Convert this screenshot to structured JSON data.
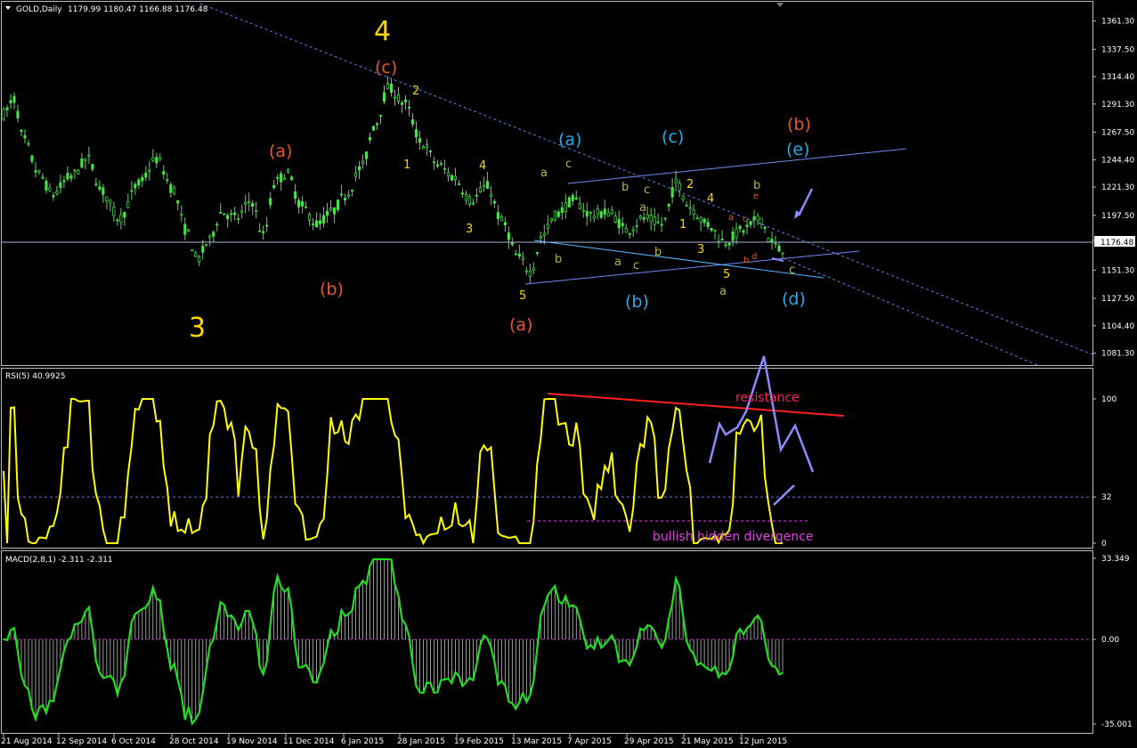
{
  "main": {
    "symbol": "GOLD,Daily",
    "ohlc": "1179.99 1180.47 1166.88 1176.48",
    "current_price": "1176.48",
    "price_axis": [
      "1361.30",
      "1337.50",
      "1314.40",
      "1291.30",
      "1267.50",
      "1244.40",
      "1221.30",
      "1197.50",
      "1176.48",
      "1151.30",
      "1127.50",
      "1104.40",
      "1081.30"
    ],
    "wave_labels": [
      {
        "text": "4",
        "color": "#ffd700",
        "size": "big"
      },
      {
        "text": "3",
        "color": "#ffd700",
        "size": "big"
      },
      {
        "text": "(c)",
        "color": "#e8572a",
        "size": "mid"
      },
      {
        "text": "(a)",
        "color": "#e8572a",
        "size": "mid"
      },
      {
        "text": "(b)",
        "color": "#e8572a",
        "size": "mid"
      },
      {
        "text": "(a)",
        "color": "#e8572a",
        "size": "mid"
      },
      {
        "text": "(b)",
        "color": "#e8572a",
        "size": "mid"
      },
      {
        "text": "(a)",
        "color": "#29a9e8",
        "size": "mid"
      },
      {
        "text": "(c)",
        "color": "#29a9e8",
        "size": "mid"
      },
      {
        "text": "(e)",
        "color": "#29a9e8",
        "size": "mid"
      },
      {
        "text": "(b)",
        "color": "#29a9e8",
        "size": "mid"
      },
      {
        "text": "(d)",
        "color": "#29a9e8",
        "size": "mid"
      },
      {
        "text": "2",
        "color": "#ffd700",
        "size": "small"
      },
      {
        "text": "1",
        "color": "#ffd700",
        "size": "small"
      },
      {
        "text": "4",
        "color": "#ffd700",
        "size": "small"
      },
      {
        "text": "3",
        "color": "#ffd700",
        "size": "small"
      },
      {
        "text": "5",
        "color": "#ffd700",
        "size": "small"
      },
      {
        "text": "2",
        "color": "#ffd700",
        "size": "small"
      },
      {
        "text": "1",
        "color": "#ffd700",
        "size": "small"
      },
      {
        "text": "4",
        "color": "#ffd700",
        "size": "small"
      },
      {
        "text": "3",
        "color": "#ffd700",
        "size": "small"
      },
      {
        "text": "5",
        "color": "#ffd700",
        "size": "small"
      },
      {
        "text": "a",
        "color": "#b5b542",
        "size": "small"
      },
      {
        "text": "c",
        "color": "#b5b542",
        "size": "small"
      },
      {
        "text": "b",
        "color": "#b5b542",
        "size": "small"
      },
      {
        "text": "a",
        "color": "#b5b542",
        "size": "small"
      },
      {
        "text": "c",
        "color": "#b5b542",
        "size": "small"
      },
      {
        "text": "b",
        "color": "#b5b542",
        "size": "small"
      },
      {
        "text": "b",
        "color": "#b5b542",
        "size": "small"
      },
      {
        "text": "c",
        "color": "#b5b542",
        "size": "small"
      },
      {
        "text": "a",
        "color": "#b5b542",
        "size": "small"
      },
      {
        "text": "b",
        "color": "#b5b542",
        "size": "small"
      },
      {
        "text": "a",
        "color": "#b5b542",
        "size": "small"
      },
      {
        "text": "c",
        "color": "#b5b542",
        "size": "small"
      },
      {
        "text": "a",
        "color": "#e8572a",
        "size": "tiny"
      },
      {
        "text": "c",
        "color": "#e8572a",
        "size": "tiny"
      },
      {
        "text": "e",
        "color": "#e8572a",
        "size": "tiny"
      },
      {
        "text": "b",
        "color": "#e8572a",
        "size": "tiny"
      },
      {
        "text": "d",
        "color": "#e8572a",
        "size": "tiny"
      }
    ]
  },
  "rsi": {
    "label": "RSI(5) 40.9925",
    "axis": [
      "100",
      "32",
      "0"
    ],
    "annotations": {
      "resistance": "resistance",
      "divergence": "bullish hidden divergence"
    }
  },
  "macd": {
    "label": "MACD(2,8,1) -2.311 -2.311",
    "axis": [
      "33.349",
      "0.00",
      "-35.001"
    ]
  },
  "x_axis": [
    "21 Aug 2014",
    "12 Sep 2014",
    "6 Oct 2014",
    "28 Oct 2014",
    "19 Nov 2014",
    "11 Dec 2014",
    "6 Jan 2015",
    "28 Jan 2015",
    "19 Feb 2015",
    "13 Mar 2015",
    "7 Apr 2015",
    "29 Apr 2015",
    "21 May 2015",
    "12 Jun 2015"
  ],
  "colors": {
    "background": "#000000",
    "candle": "#4fe04f",
    "rsi_line": "#ffff00",
    "macd_line": "#22dd22",
    "arrows": "#8c8cff",
    "resistance": "#ff2020",
    "divergence": "#e040e0",
    "trend": "#5a82e6"
  },
  "chart_data": [
    {
      "type": "line",
      "title": "GOLD,Daily",
      "ylabel": "",
      "ylim": [
        1070,
        1370
      ],
      "x": [
        "21 Aug 2014",
        "12 Sep 2014",
        "6 Oct 2014",
        "28 Oct 2014",
        "19 Nov 2014",
        "11 Dec 2014",
        "6 Jan 2015",
        "28 Jan 2015",
        "19 Feb 2015",
        "13 Mar 2015",
        "7 Apr 2015",
        "29 Apr 2015",
        "21 May 2015",
        "12 Jun 2015"
      ],
      "series": [
        {
          "name": "GOLD",
          "values": [
            1283,
            1230,
            1225,
            1165,
            1195,
            1200,
            1225,
            1280,
            1218,
            1160,
            1205,
            1200,
            1195,
            1176.48
          ]
        }
      ]
    },
    {
      "type": "line",
      "title": "RSI(5) 40.9925",
      "ylim": [
        0,
        100
      ],
      "x": [
        "21 Aug 2014",
        "12 Sep 2014",
        "6 Oct 2014",
        "28 Oct 2014",
        "19 Nov 2014",
        "11 Dec 2014",
        "6 Jan 2015",
        "28 Jan 2015",
        "19 Feb 2015",
        "13 Mar 2015",
        "7 Apr 2015",
        "29 Apr 2015",
        "21 May 2015",
        "12 Jun 2015"
      ],
      "series": [
        {
          "name": "RSI(5)",
          "values": [
            45,
            30,
            85,
            12,
            70,
            35,
            95,
            55,
            35,
            10,
            60,
            45,
            25,
            40.99
          ]
        }
      ]
    },
    {
      "type": "line",
      "title": "MACD(2,8,1) -2.311 -2.311",
      "ylim": [
        -35.001,
        33.349
      ],
      "x": [
        "21 Aug 2014",
        "12 Sep 2014",
        "6 Oct 2014",
        "28 Oct 2014",
        "19 Nov 2014",
        "11 Dec 2014",
        "6 Jan 2015",
        "28 Jan 2015",
        "19 Feb 2015",
        "13 Mar 2015",
        "7 Apr 2015",
        "29 Apr 2015",
        "21 May 2015",
        "12 Jun 2015"
      ],
      "series": [
        {
          "name": "MACD",
          "values": [
            -8,
            -12,
            10,
            -33,
            12,
            -10,
            33,
            -18,
            -10,
            -20,
            12,
            6,
            -10,
            -2.311
          ]
        }
      ]
    }
  ]
}
